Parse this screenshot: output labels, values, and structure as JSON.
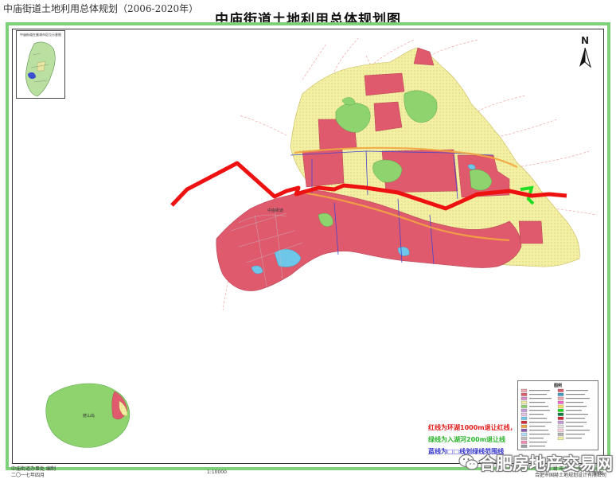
{
  "header": {
    "top_caption": "中庙街道土地利用总体规划（2006-2020年）",
    "map_title": "中庙街道土地利用总体规划图"
  },
  "north": {
    "label": "N"
  },
  "inset": {
    "title": "中庙街道在巢湖市区位示意图"
  },
  "map_labels": {
    "town": "中庙街道",
    "island": "姥山岛"
  },
  "notes": {
    "red": "红线为环湖1000m退让红线，",
    "green": "绿线为入湖河200m退让线",
    "blue": "蓝线为□□线划绿线范围线"
  },
  "legend": {
    "title": "图例"
  },
  "footer": {
    "left_line1": "中庙街道办事处    编制",
    "left_line2": "二〇一七年四月",
    "scale": "1:10000",
    "right_line1": "巢 湖 市 国 土 资 源 局",
    "right_line2": "合肥市国赫土地规划设计有限公司",
    "right_tail": "制图"
  },
  "watermark": {
    "text": "合肥房地产交易网"
  },
  "colors": {
    "frame_green": "#7fd07a",
    "urban_red": "#e05a6e",
    "rural_yellow": "#f3f0a4",
    "green_space": "#8fd36f",
    "water_blue": "#6ec6e8",
    "redline": "#ee1111",
    "greenline": "#22dd22",
    "blueline": "#3333cc"
  }
}
